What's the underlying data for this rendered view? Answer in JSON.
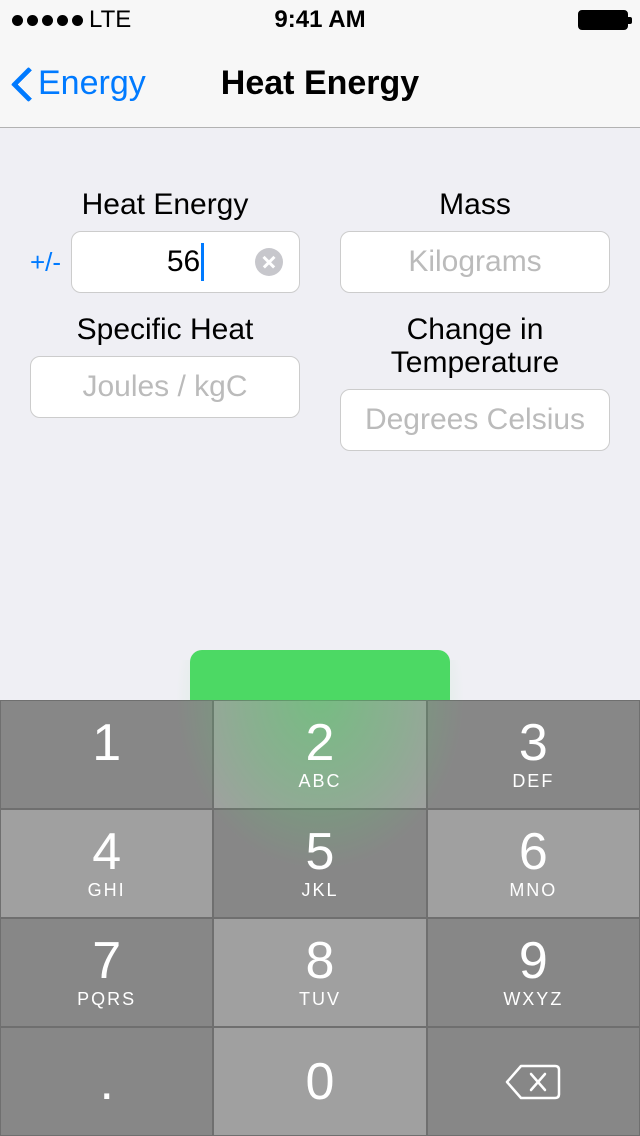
{
  "status": {
    "carrier": "LTE",
    "time": "9:41 AM"
  },
  "nav": {
    "back_label": "Energy",
    "title": "Heat Energy"
  },
  "fields": {
    "heat_energy": {
      "label": "Heat Energy",
      "sign": "+/-",
      "value": "56"
    },
    "mass": {
      "label": "Mass",
      "placeholder": "Kilograms"
    },
    "specific_heat": {
      "label": "Specific Heat",
      "placeholder": "Joules / kgC"
    },
    "change_temp": {
      "label": "Change in Temperature",
      "placeholder": "Degrees Celsius"
    }
  },
  "keypad": {
    "k1": "1",
    "k2": "2",
    "k2l": "ABC",
    "k3": "3",
    "k3l": "DEF",
    "k4": "4",
    "k4l": "GHI",
    "k5": "5",
    "k5l": "JKL",
    "k6": "6",
    "k6l": "MNO",
    "k7": "7",
    "k7l": "PQRS",
    "k8": "8",
    "k8l": "TUV",
    "k9": "9",
    "k9l": "WXYZ",
    "kdot": ".",
    "k0": "0"
  }
}
